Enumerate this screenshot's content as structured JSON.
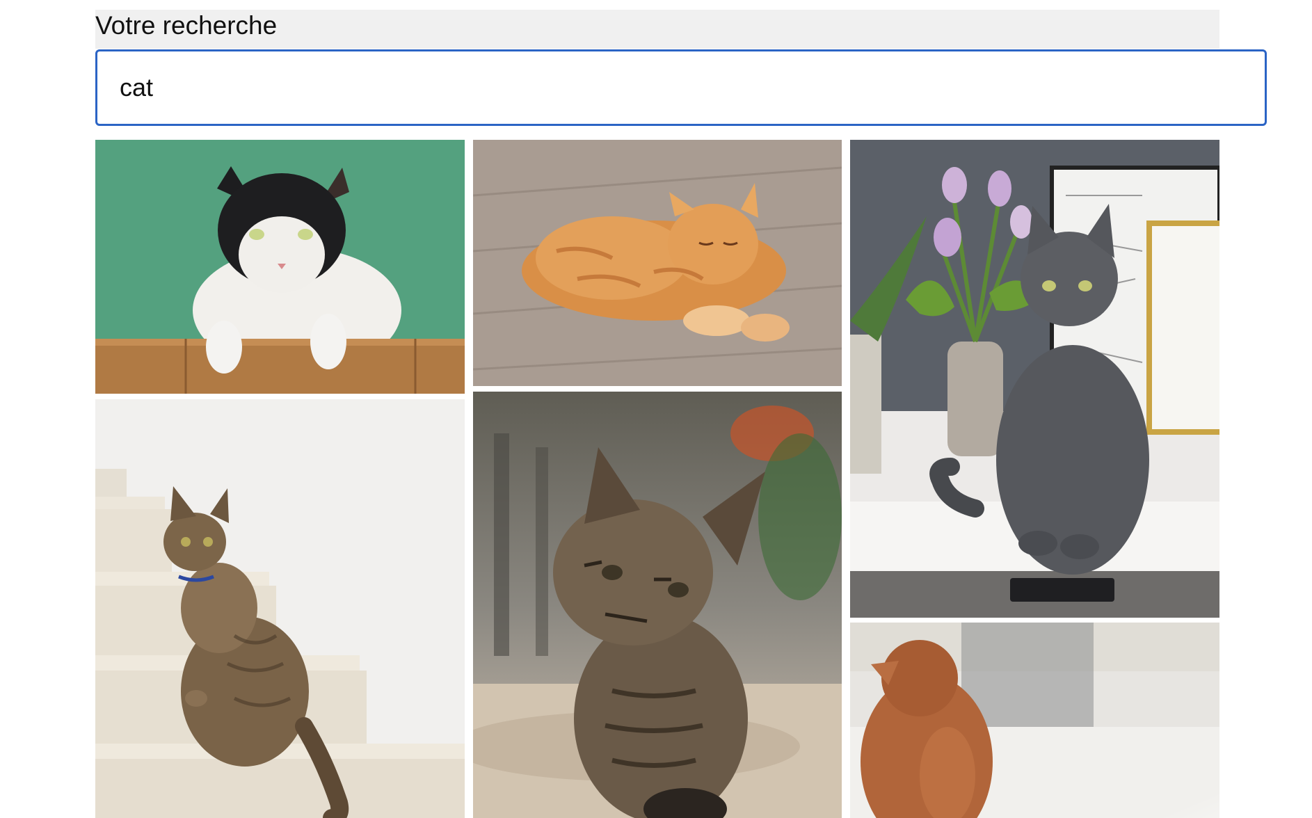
{
  "search": {
    "label": "Votre recherche",
    "value": "cat",
    "accent_color": "#2b64c5"
  },
  "results": [
    {
      "icon": "cat-photo-black-white-green-wall"
    },
    {
      "icon": "cat-photo-orange-sleeping-floor"
    },
    {
      "icon": "cat-photo-grey-tulips-shelf"
    },
    {
      "icon": "cat-photo-tabby-on-stairs"
    },
    {
      "icon": "cat-photo-tabby-kitten"
    },
    {
      "icon": "cat-photo-orange-back-view"
    }
  ]
}
